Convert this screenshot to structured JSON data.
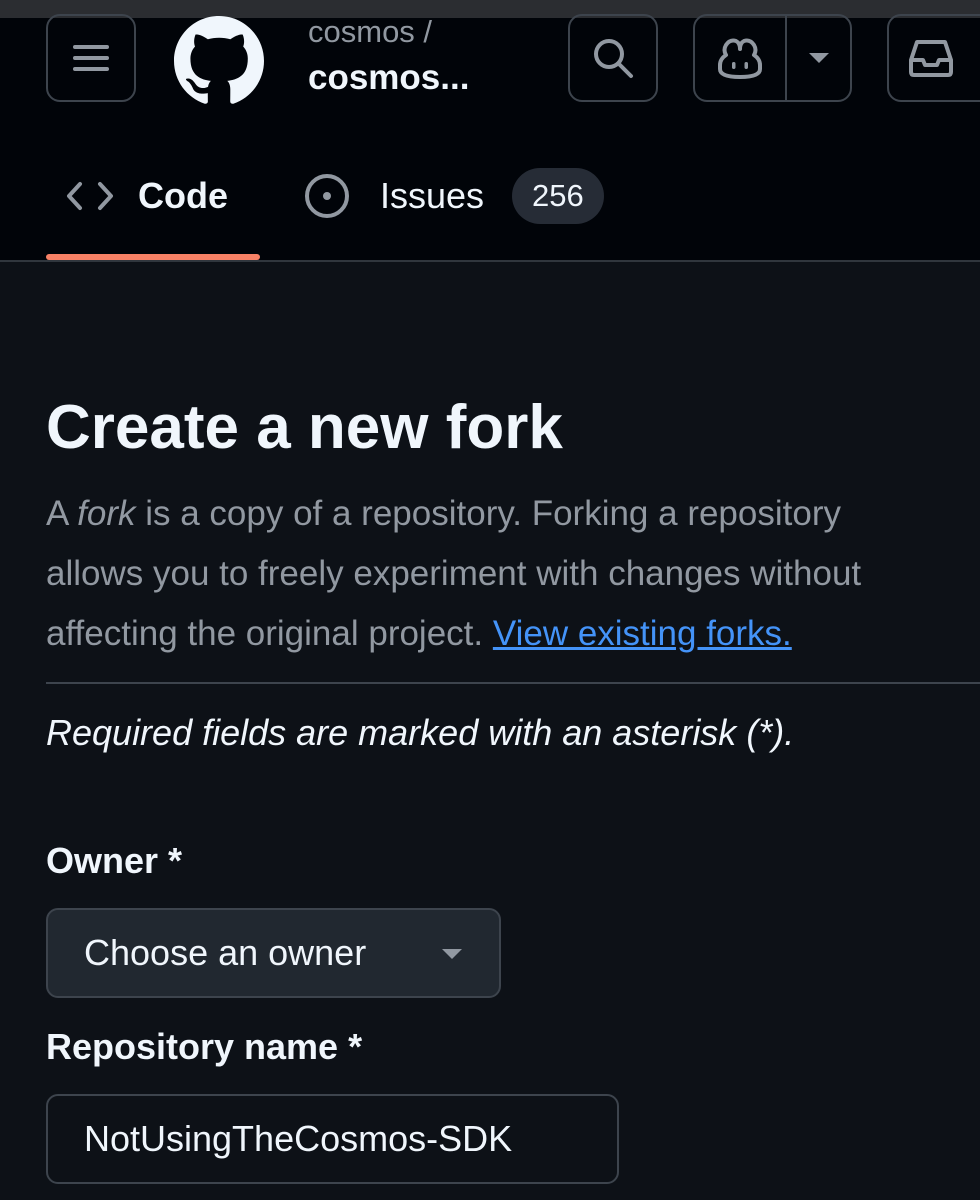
{
  "header": {
    "repo_owner": "cosmos /",
    "repo_name": "cosmos...",
    "icons": {
      "menu": "hamburger-menu-icon",
      "logo": "github-mark-icon",
      "search": "search-icon",
      "copilot": "copilot-icon",
      "copilot_caret": "caret-down-icon",
      "inbox": "inbox-icon"
    }
  },
  "tabs": [
    {
      "label": "Code",
      "icon": "code-icon",
      "selected": true
    },
    {
      "label": "Issues",
      "icon": "issue-opened-icon",
      "counter": "256",
      "selected": false
    }
  ],
  "main": {
    "title": "Create a new fork",
    "description": {
      "part1": "A ",
      "fork_word": "fork",
      "part2": " is a copy of a repository. Forking a repository",
      "line2": "allows you to freely experiment with changes without",
      "line3": "affecting the original project. ",
      "link": "View existing forks."
    },
    "required_note": "Required fields are marked with an asterisk (*).",
    "owner": {
      "label": "Owner *",
      "selected": "Choose an owner"
    },
    "repo_name": {
      "label": "Repository name *",
      "value": "NotUsingTheCosmos-SDK"
    }
  },
  "colors": {
    "background": "#0d1117",
    "header_background": "#010409",
    "accent_underline": "#f78166",
    "link": "#4493f8",
    "muted_text": "#9198a1"
  }
}
